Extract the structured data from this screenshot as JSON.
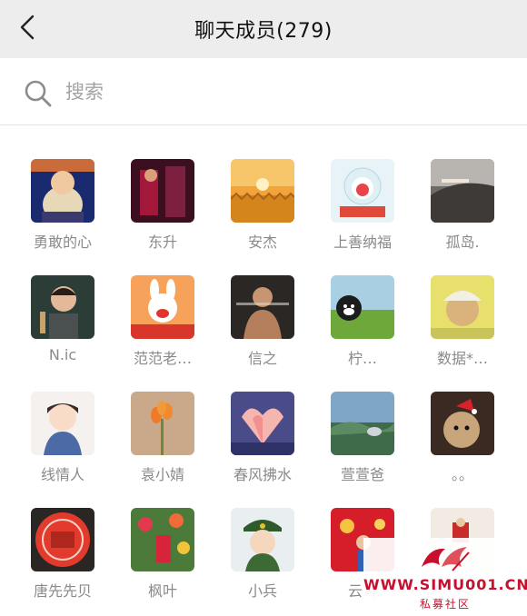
{
  "nav": {
    "title": "聊天成员(279)",
    "back_icon": "chevron-left-icon"
  },
  "search": {
    "placeholder": "搜索",
    "icon": "search-icon"
  },
  "members": [
    {
      "name": "勇敢的心"
    },
    {
      "name": "东升"
    },
    {
      "name": "安杰"
    },
    {
      "name": "上善纳福"
    },
    {
      "name": "孤岛."
    },
    {
      "name": "N.ic"
    },
    {
      "name": "范范老…"
    },
    {
      "name": "信之"
    },
    {
      "name": "柠…"
    },
    {
      "name": "数据*…"
    },
    {
      "name": "线情人"
    },
    {
      "name": "袁小婧"
    },
    {
      "name": "春风拂水"
    },
    {
      "name": "萱萱爸"
    },
    {
      "name": "。。"
    },
    {
      "name": "唐先先贝"
    },
    {
      "name": "枫叶"
    },
    {
      "name": "小兵"
    },
    {
      "name": "云霄"
    },
    {
      "name": ""
    }
  ],
  "watermark": {
    "url": "WWW.SIMU001.CN",
    "subtitle": "私募社区",
    "color": "#c8102e"
  }
}
